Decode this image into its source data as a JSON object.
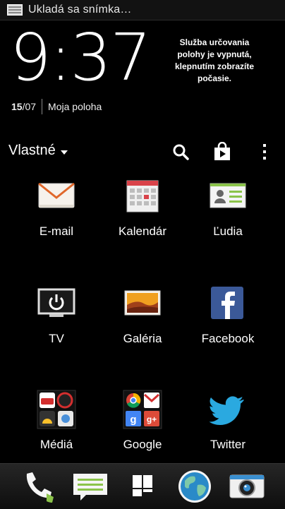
{
  "status_bar": {
    "notification_text": "Ukladá sa snímka…"
  },
  "clock_widget": {
    "time": "9:37",
    "date_day": "15",
    "date_month": "/07",
    "location": "Moja poloha",
    "weather_message": "Služba určovania polohy je vypnutá, klepnutím zobrazíte počasie."
  },
  "toolbar": {
    "folder_label": "Vlastné"
  },
  "apps": [
    {
      "label": "E-mail",
      "icon": "email-icon"
    },
    {
      "label": "Kalendár",
      "icon": "calendar-icon"
    },
    {
      "label": "Ľudia",
      "icon": "people-icon"
    },
    {
      "label": "TV",
      "icon": "tv-icon"
    },
    {
      "label": "Galéria",
      "icon": "gallery-icon"
    },
    {
      "label": "Facebook",
      "icon": "facebook-icon"
    },
    {
      "label": "Médiá",
      "icon": "media-folder-icon"
    },
    {
      "label": "Google",
      "icon": "google-folder-icon"
    },
    {
      "label": "Twitter",
      "icon": "twitter-icon"
    }
  ],
  "dock": [
    "phone-icon",
    "messages-icon",
    "all-apps-icon",
    "internet-icon",
    "camera-icon"
  ],
  "colors": {
    "background": "#000000",
    "text": "#ffffff",
    "accent_green": "#8bc34a"
  }
}
